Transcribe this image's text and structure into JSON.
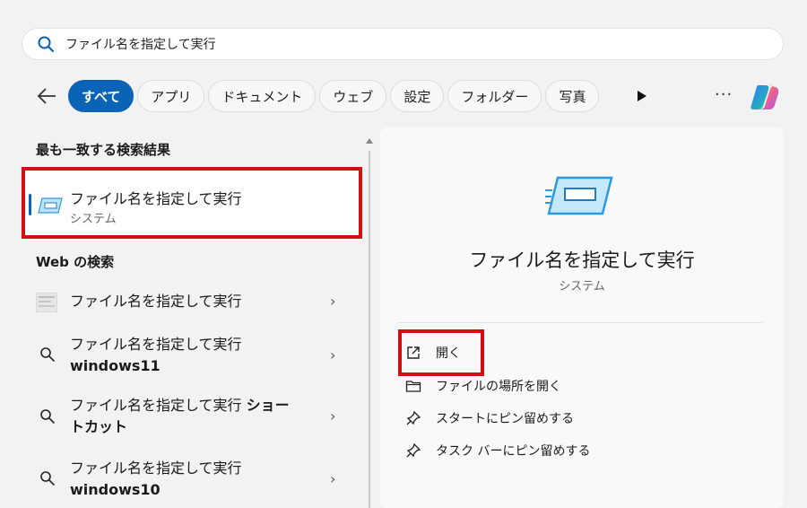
{
  "search": {
    "query": "ファイル名を指定して実行"
  },
  "filters": [
    "すべて",
    "アプリ",
    "ドキュメント",
    "ウェブ",
    "設定",
    "フォルダー",
    "写真"
  ],
  "left": {
    "best_match_title": "最も一致する検索結果",
    "best_match": {
      "name": "ファイル名を指定して実行",
      "type": "システム"
    },
    "web_title": "Web の検索",
    "web_results": [
      {
        "text": "ファイル名を指定して実行",
        "bold": "",
        "icon": "web-thumbnail-icon"
      },
      {
        "text": "ファイル名を指定して実行",
        "bold": "windows11",
        "icon": "search-icon"
      },
      {
        "text": "ファイル名を指定して実行 ",
        "bold": "ショートカット",
        "icon": "search-icon"
      },
      {
        "text": "ファイル名を指定して実行",
        "bold": "windows10",
        "icon": "search-icon"
      }
    ]
  },
  "detail": {
    "title": "ファイル名を指定して実行",
    "subtitle": "システム",
    "actions": [
      {
        "label": "開く",
        "icon": "open-external-icon"
      },
      {
        "label": "ファイルの場所を開く",
        "icon": "folder-icon"
      },
      {
        "label": "スタートにピン留めする",
        "icon": "pin-icon"
      },
      {
        "label": "タスク バーにピン留めする",
        "icon": "pin-icon"
      }
    ]
  },
  "colors": {
    "accent": "#0b63b6",
    "highlight": "#d20f12"
  }
}
